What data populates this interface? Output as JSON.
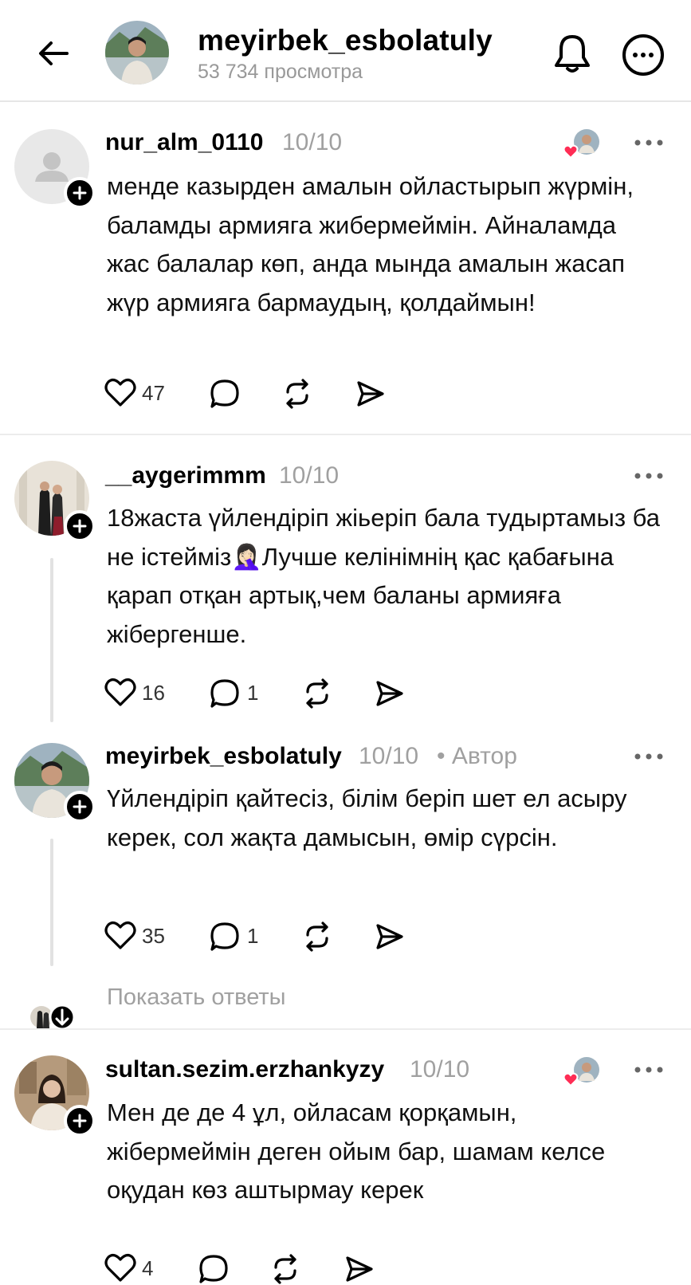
{
  "header": {
    "username": "meyirbek_esbolatuly",
    "views": "53 734 просмотра"
  },
  "threads": [
    {
      "username": "nur_alm_0110",
      "date": "10/10",
      "text": "менде казырден амалын ойластырып жүрмін, баламды армияга жибермеймін. Айналамда жас балалар көп, анда мында амалын жасап жүр армияга бармаудың, қолдаймын!",
      "likes": "47",
      "replies": "",
      "liked_by_author": true
    },
    {
      "username": "__aygerimmm",
      "date": "10/10",
      "text": "18жаста үйлендіріп жіьеріп бала тудыртамыз ба не істейміз🤦🏻‍♀️Лучше келінімнің қас қабағына қарап отқан артық,чем баланы армияға жібергенше.",
      "likes": "16",
      "replies": "1"
    },
    {
      "username": "meyirbek_esbolatuly",
      "date": "10/10",
      "author_label": "• Автор",
      "text": "Үйлендіріп қайтесіз, білім беріп шет ел асыру керек, сол жақта дамысын, өмір сүрсін.",
      "likes": "35",
      "replies": "1"
    },
    {
      "username": "sultan.sezim.erzhankyzy",
      "date": "10/10",
      "text": "Мен де де 4 ұл, ойласам қорқамын, жібермеймін деген ойым бар, шамам келсе оқудан көз аштырмау керек",
      "likes": "4",
      "replies": "",
      "liked_by_author": true
    }
  ],
  "show_replies_label": "Показать ответы",
  "icons": [
    "back-arrow-icon",
    "bell-icon",
    "more-icon",
    "heart-icon",
    "comment-icon",
    "repost-icon",
    "share-icon",
    "plus-icon",
    "arrow-down-icon"
  ],
  "colors": {
    "like_red": "#ff2d55",
    "muted": "#a0a0a0",
    "divider": "#ececec"
  }
}
